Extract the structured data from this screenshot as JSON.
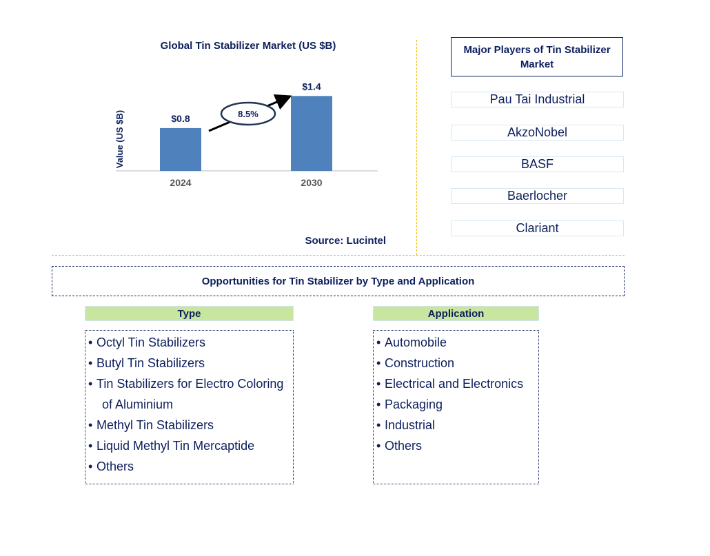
{
  "chart_data": {
    "type": "bar",
    "title": "Global Tin Stabilizer Market (US $B)",
    "xlabel": "",
    "ylabel": "Value (US $B)",
    "categories": [
      "2024",
      "2030"
    ],
    "values": [
      0.8,
      1.4
    ],
    "data_labels": [
      "$0.8",
      "$1.4"
    ],
    "ylim": [
      0,
      1.6
    ],
    "grid": false,
    "bar_color": "#4f81bd",
    "annotation": {
      "text": "8.5%",
      "meaning": "CAGR 2024-2030",
      "shape": "ellipse-on-arrow"
    },
    "source": "Source: Lucintel"
  },
  "players": {
    "header": "Major Players of Tin Stabilizer Market",
    "items": [
      "Pau Tai Industrial",
      "AkzoNobel",
      "BASF",
      "Baerlocher",
      "Clariant"
    ]
  },
  "opportunities": {
    "title": "Opportunities for Tin Stabilizer by Type and Application",
    "type": {
      "header": "Type",
      "items": [
        "Octyl Tin Stabilizers",
        "Butyl Tin Stabilizers",
        "Tin Stabilizers for Electro Coloring",
        "of Aluminium",
        "Methyl Tin Stabilizers",
        "Liquid Methyl Tin Mercaptide",
        "Others"
      ],
      "continuation_index": 3
    },
    "application": {
      "header": "Application",
      "items": [
        "Automobile",
        "Construction",
        "Electrical and Electronics",
        "Packaging",
        "Industrial",
        "Others"
      ]
    }
  },
  "colors": {
    "text": "#0d1f5c",
    "bar": "#4f81bd",
    "divider": "#f5b800",
    "segment_header": "#c8e6a0"
  }
}
